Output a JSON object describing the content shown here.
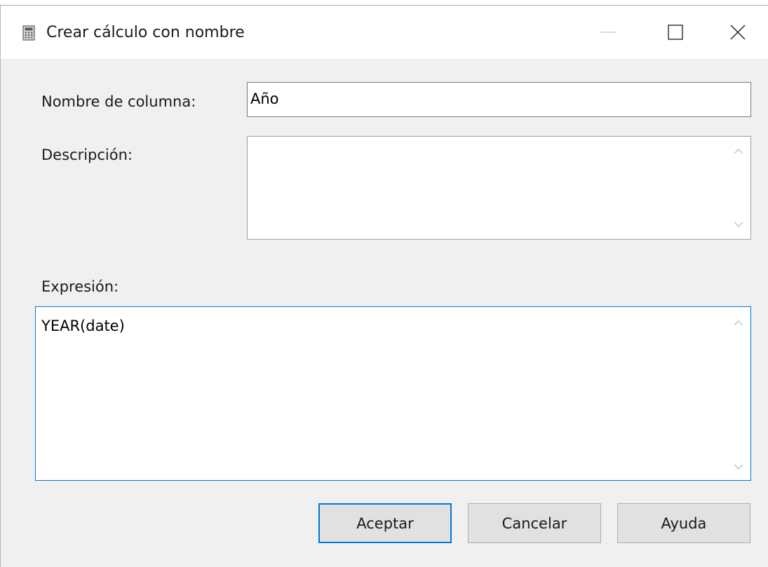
{
  "window": {
    "title": "Crear cálculo con nombre",
    "icon": "calculator-icon"
  },
  "form": {
    "column_name_label": "Nombre de columna:",
    "column_name_value": "Año",
    "description_label": "Descripción:",
    "description_value": "",
    "expression_label": "Expresión:",
    "expression_value": "YEAR(date)"
  },
  "buttons": {
    "ok_label": "Aceptar",
    "cancel_label": "Cancelar",
    "help_label": "Ayuda"
  },
  "colors": {
    "dialog_background": "#f0f0f0",
    "focus_border": "#0078d7",
    "button_background": "#e1e1e1"
  }
}
